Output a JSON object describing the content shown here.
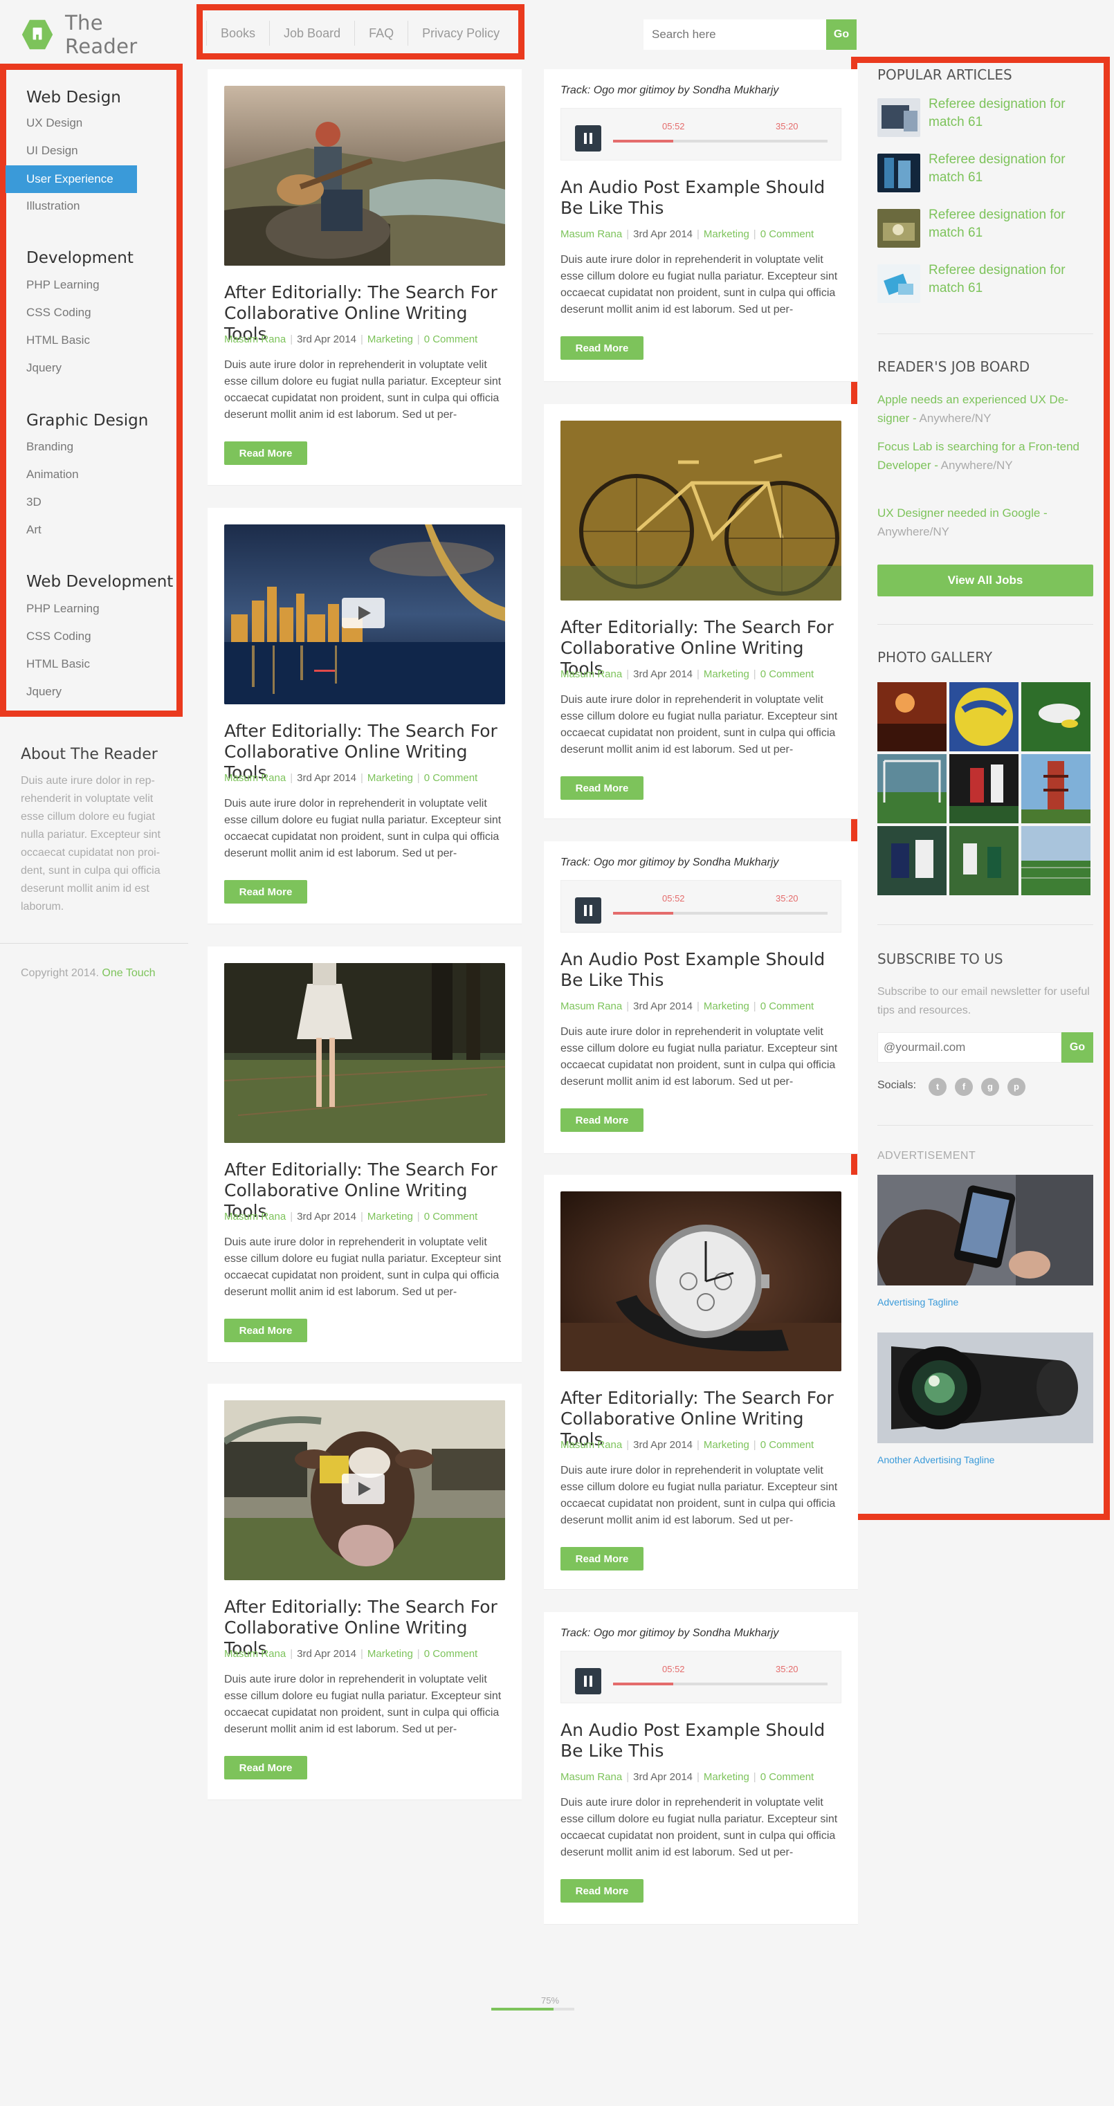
{
  "header": {
    "site_title": "The Reader",
    "nav": [
      "Books",
      "Job Board",
      "FAQ",
      "Privacy Policy"
    ],
    "search_placeholder": "Search here",
    "search_button": "Go"
  },
  "sidebar": {
    "groups": [
      {
        "title": "Web Design",
        "items": [
          "UX Design",
          "UI Design",
          "User Experience",
          "Illustration"
        ]
      },
      {
        "title": "Development",
        "items": [
          "PHP Learning",
          "CSS Coding",
          "HTML Basic",
          "Jquery"
        ]
      },
      {
        "title": "Graphic Design",
        "items": [
          "Branding",
          "Animation",
          "3D",
          "Art"
        ]
      },
      {
        "title": "Web Development",
        "items": [
          "PHP Learning",
          "CSS Coding",
          "HTML Basic",
          "Jquery"
        ]
      }
    ],
    "active_item": "User Experience",
    "active_color": "#3a9ad9",
    "about_title": "About The Reader",
    "about_text": "Duis aute irure dolor in rep-rehenderit in voluptate velit esse cillum dolore eu fugiat nulla pariatur. Excepteur sint occaecat cupidatat non proi-dent, sunt in culpa qui officia deserunt mollit anim id est laborum.",
    "copyright_prefix": "Copyright 2014.",
    "copyright_link": "One Touch"
  },
  "post_common": {
    "author": "Masum Rana",
    "date": "3rd Apr 2014",
    "category": "Marketing",
    "comments": "0 Comment",
    "excerpt": "Duis aute irure dolor in reprehenderit in voluptate velit esse cillum dolore eu fugiat nulla pariatur. Excepteur sint occaecat cupidatat non proident, sunt in culpa qui officia deserunt mollit anim id est laborum. Sed ut per-",
    "read_more": "Read More",
    "article_title": "After Editorially: The Search For Collaborative Online Writing Tools",
    "audio_title": "An Audio Post Example Should Be Like This",
    "track": "Track: Ogo mor gitimoy by Sondha Mukharjy",
    "elapsed": "05:52",
    "duration": "35:20",
    "progress": 0.28
  },
  "left_posts": [
    {
      "image": "guitar-man-photo",
      "video": false
    },
    {
      "image": "city-night-photo",
      "video": true
    },
    {
      "image": "girl-dress-photo",
      "video": false
    },
    {
      "image": "cow-photo",
      "video": true
    }
  ],
  "right_posts": [
    {
      "kind": "audio"
    },
    {
      "kind": "image",
      "image": "bicycle-photo"
    },
    {
      "kind": "audio"
    },
    {
      "kind": "image",
      "image": "watch-photo"
    },
    {
      "kind": "audio"
    }
  ],
  "right_sidebar": {
    "popular_title": "POPULAR ARTICLES",
    "popular": [
      "Referee designation for match 61",
      "Referee designation for match 61",
      "Referee designation for match 61",
      "Referee designation for match 61"
    ],
    "jobs_title": "READER'S JOB BOARD",
    "jobs": [
      {
        "title": "Apple needs an experienced UX De-signer -",
        "loc": "Anywhere/NY"
      },
      {
        "title": "Focus Lab is searching for a Fron-tend Developer -",
        "loc": "Anywhere/NY"
      },
      {
        "title": "UX Designer needed in Google  -",
        "loc": "Anywhere/NY"
      }
    ],
    "view_all": "View All Jobs",
    "gallery_title": "PHOTO GALLERY",
    "subscribe_title": "SUBSCRIBE TO US",
    "subscribe_text": "Subscribe to our email newsletter for useful tips and resources.",
    "email_placeholder": "@yourmail.com",
    "email_button": "Go",
    "socials_label": "Socials:",
    "social_icons": [
      "twitter-icon",
      "facebook-icon",
      "google-plus-icon",
      "pinterest-icon"
    ],
    "ad_title": "ADVERTISEMENT",
    "ad_caption_1": "Advertising Tagline",
    "ad_caption_2": "Another Advertising Tagline"
  },
  "pager": {
    "percent_label": "75%",
    "progress": 0.75
  },
  "accent_color": "#7dc35b",
  "highlight_color": "#ea3a1e"
}
